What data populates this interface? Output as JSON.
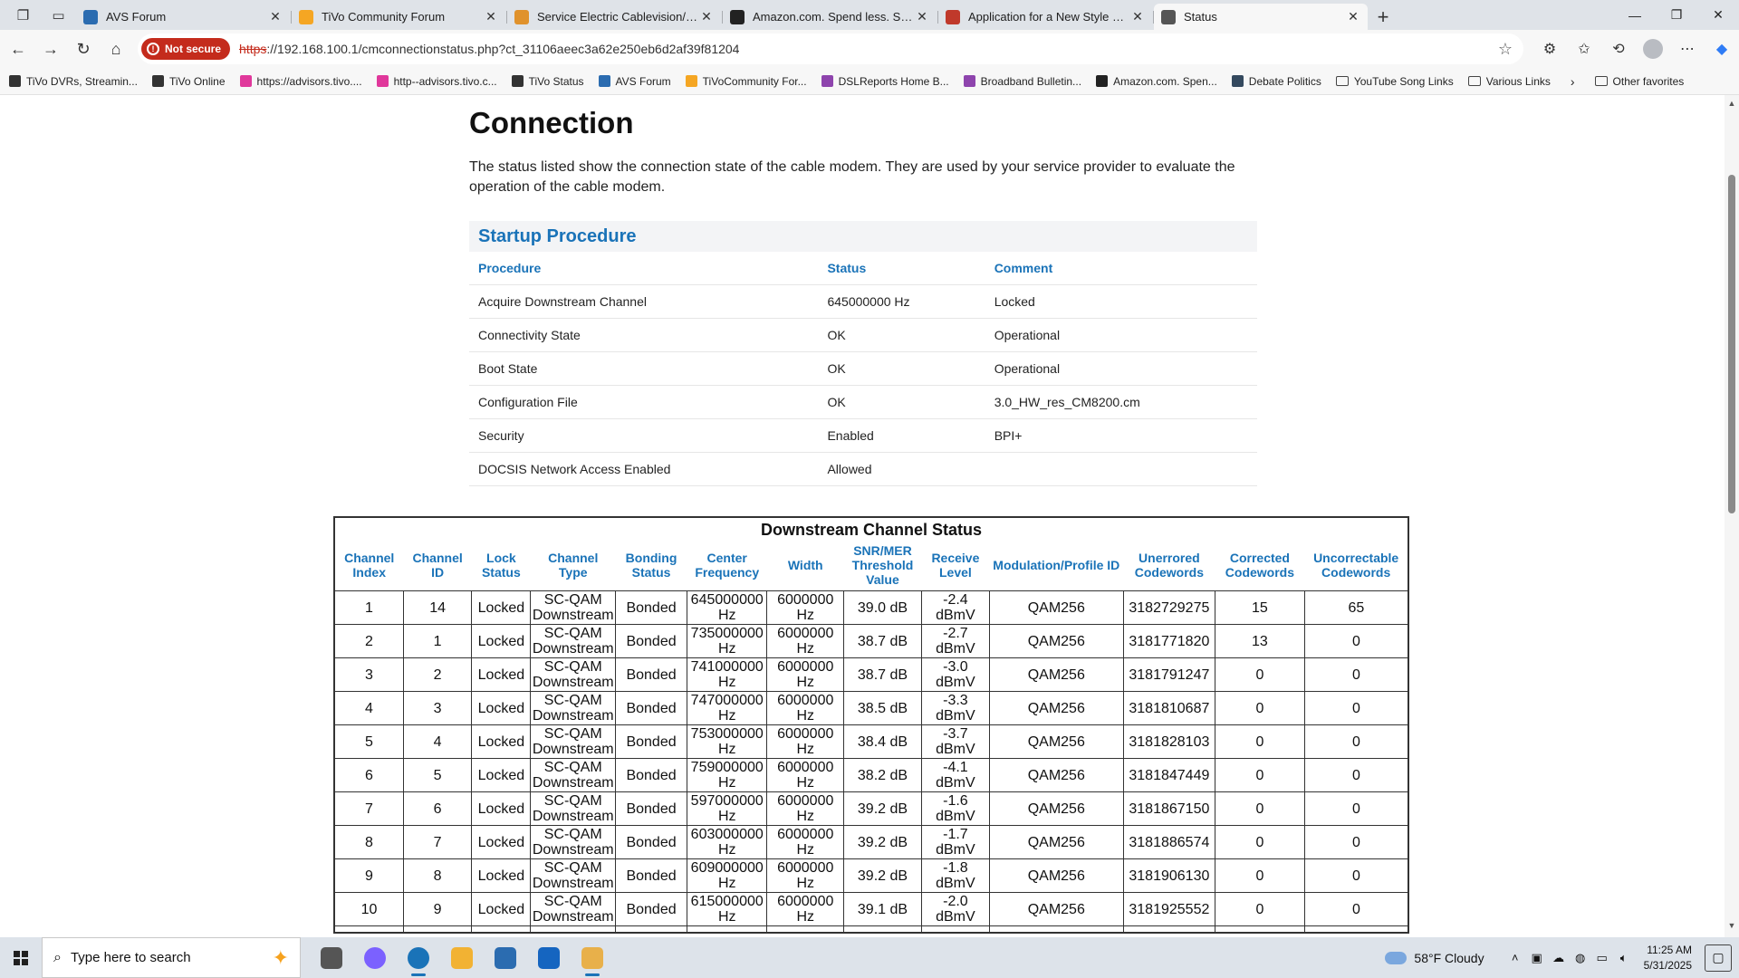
{
  "browser": {
    "tabs": [
      {
        "title": "AVS Forum",
        "color": "#2b6cb0"
      },
      {
        "title": "TiVo Community Forum",
        "color": "#f5a623"
      },
      {
        "title": "Service Electric Cablevision/Servic",
        "color": "#e0922c"
      },
      {
        "title": "Amazon.com. Spend less. Smile m",
        "color": "#222222"
      },
      {
        "title": "Application for a New Style Regist",
        "color": "#c0392b"
      },
      {
        "title": "Status",
        "color": "#555555"
      }
    ],
    "address": {
      "security_label": "Not secure",
      "scheme": "https",
      "rest": "://192.168.100.1/cmconnectionstatus.php?ct_31106aeec3a62e250eb6d2af39f81204"
    },
    "favorites": [
      {
        "label": "TiVo DVRs, Streamin...",
        "color": "#333333"
      },
      {
        "label": "TiVo Online",
        "color": "#333333"
      },
      {
        "label": "https://advisors.tivo....",
        "color": "#e0389b"
      },
      {
        "label": "http--advisors.tivo.c...",
        "color": "#e0389b"
      },
      {
        "label": "TiVo Status",
        "color": "#333333"
      },
      {
        "label": "AVS Forum",
        "color": "#2b6cb0"
      },
      {
        "label": "TiVoCommunity For...",
        "color": "#f5a623"
      },
      {
        "label": "DSLReports Home B...",
        "color": "#8e44ad"
      },
      {
        "label": "Broadband Bulletin...",
        "color": "#8e44ad"
      },
      {
        "label": "Amazon.com. Spen...",
        "color": "#222222"
      },
      {
        "label": "Debate Politics",
        "color": "#34495e"
      }
    ],
    "favorite_folders": [
      "YouTube Song Links",
      "Various Links"
    ],
    "other_favorites": "Other favorites"
  },
  "page": {
    "title": "Connection",
    "intro": "The status listed show the connection state of the cable modem. They are used by your service provider to evaluate the operation of the cable modem.",
    "startup": {
      "heading": "Startup Procedure",
      "columns": [
        "Procedure",
        "Status",
        "Comment"
      ],
      "rows": [
        [
          "Acquire Downstream Channel",
          "645000000 Hz",
          "Locked"
        ],
        [
          "Connectivity State",
          "OK",
          "Operational"
        ],
        [
          "Boot State",
          "OK",
          "Operational"
        ],
        [
          "Configuration File",
          "OK",
          "3.0_HW_res_CM8200.cm"
        ],
        [
          "Security",
          "Enabled",
          "BPI+"
        ],
        [
          "DOCSIS Network Access Enabled",
          "Allowed",
          ""
        ]
      ]
    },
    "downstream": {
      "title": "Downstream Channel Status",
      "columns": [
        "Channel Index",
        "Channel ID",
        "Lock Status",
        "Channel Type",
        "Bonding Status",
        "Center Frequency",
        "Width",
        "SNR/MER Threshold Value",
        "Receive Level",
        "Modulation/Profile ID",
        "Unerrored Codewords",
        "Corrected Codewords",
        "Uncorrectable Codewords"
      ],
      "rows": [
        [
          "1",
          "14",
          "Locked",
          "SC-QAM Downstream",
          "Bonded",
          "645000000 Hz",
          "6000000 Hz",
          "39.0 dB",
          "-2.4 dBmV",
          "QAM256",
          "3182729275",
          "15",
          "65"
        ],
        [
          "2",
          "1",
          "Locked",
          "SC-QAM Downstream",
          "Bonded",
          "735000000 Hz",
          "6000000 Hz",
          "38.7 dB",
          "-2.7 dBmV",
          "QAM256",
          "3181771820",
          "13",
          "0"
        ],
        [
          "3",
          "2",
          "Locked",
          "SC-QAM Downstream",
          "Bonded",
          "741000000 Hz",
          "6000000 Hz",
          "38.7 dB",
          "-3.0 dBmV",
          "QAM256",
          "3181791247",
          "0",
          "0"
        ],
        [
          "4",
          "3",
          "Locked",
          "SC-QAM Downstream",
          "Bonded",
          "747000000 Hz",
          "6000000 Hz",
          "38.5 dB",
          "-3.3 dBmV",
          "QAM256",
          "3181810687",
          "0",
          "0"
        ],
        [
          "5",
          "4",
          "Locked",
          "SC-QAM Downstream",
          "Bonded",
          "753000000 Hz",
          "6000000 Hz",
          "38.4 dB",
          "-3.7 dBmV",
          "QAM256",
          "3181828103",
          "0",
          "0"
        ],
        [
          "6",
          "5",
          "Locked",
          "SC-QAM Downstream",
          "Bonded",
          "759000000 Hz",
          "6000000 Hz",
          "38.2 dB",
          "-4.1 dBmV",
          "QAM256",
          "3181847449",
          "0",
          "0"
        ],
        [
          "7",
          "6",
          "Locked",
          "SC-QAM Downstream",
          "Bonded",
          "597000000 Hz",
          "6000000 Hz",
          "39.2 dB",
          "-1.6 dBmV",
          "QAM256",
          "3181867150",
          "0",
          "0"
        ],
        [
          "8",
          "7",
          "Locked",
          "SC-QAM Downstream",
          "Bonded",
          "603000000 Hz",
          "6000000 Hz",
          "39.2 dB",
          "-1.7 dBmV",
          "QAM256",
          "3181886574",
          "0",
          "0"
        ],
        [
          "9",
          "8",
          "Locked",
          "SC-QAM Downstream",
          "Bonded",
          "609000000 Hz",
          "6000000 Hz",
          "39.2 dB",
          "-1.8 dBmV",
          "QAM256",
          "3181906130",
          "0",
          "0"
        ],
        [
          "10",
          "9",
          "Locked",
          "SC-QAM Downstream",
          "Bonded",
          "615000000 Hz",
          "6000000 Hz",
          "39.1 dB",
          "-2.0 dBmV",
          "QAM256",
          "3181925552",
          "0",
          "0"
        ]
      ]
    }
  },
  "taskbar": {
    "search_placeholder": "Type here to search",
    "apps": [
      {
        "name": "task-view",
        "color": "#555555"
      },
      {
        "name": "copilot",
        "color": "#7b61ff"
      },
      {
        "name": "edge",
        "color": "#1a73b8"
      },
      {
        "name": "file-explorer",
        "color": "#f2b233"
      },
      {
        "name": "store",
        "color": "#2b6cb0"
      },
      {
        "name": "outlook",
        "color": "#1565c0"
      },
      {
        "name": "snipping",
        "color": "#e8b04a"
      }
    ],
    "weather": "58°F  Cloudy",
    "time": "11:25 AM",
    "date": "5/31/2025"
  }
}
